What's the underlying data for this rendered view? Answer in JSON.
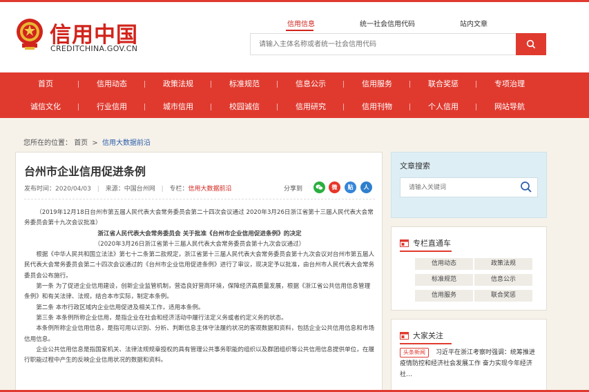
{
  "header": {
    "logo_cn": "信用中国",
    "logo_en": "CREDITCHINA.GOV.CN",
    "search_tabs": [
      "信用信息",
      "统一社会信用代码",
      "站内文章"
    ],
    "search_placeholder": "请输入主体名称或者统一社会信用代码"
  },
  "nav": {
    "row1": [
      "首页",
      "信用动态",
      "政策法规",
      "标准规范",
      "信息公示",
      "信用服务",
      "联合奖惩",
      "专项治理"
    ],
    "row2": [
      "诚信文化",
      "行业信用",
      "城市信用",
      "校园诚信",
      "信用研究",
      "信用刊物",
      "个人信用",
      "网站导航"
    ]
  },
  "breadcrumb": {
    "prefix": "您所在的位置：",
    "home": "首页",
    "sep": ">",
    "current": "信用大数据前沿"
  },
  "article": {
    "title": "台州市企业信用促进条例",
    "publish_label": "发布时间：",
    "publish_date": "2020/04/03",
    "source_label": "来源：",
    "source": "中国台州网",
    "column_label": "专栏：",
    "column": "信用大数据前沿",
    "share_label": "分享到",
    "share_weibo_glyph": "微",
    "share_tieba_glyph": "贴",
    "share_renren_glyph": "人",
    "paragraphs": [
      "（2019年12月18日台州市第五届人民代表大会常务委员会第二十四次会议通过 2020年3月26日浙江省第十三届人民代表大会常务委员会第十九次会议批准）",
      "浙江省人民代表大会常务委员会 关于批准《台州市企业信用促进条例》的决定",
      "（2020年3月26日浙江省第十三届人民代表大会常务委员会第十九次会议通过）",
      "根据《中华人民共和国立法法》第七十二条第二款规定，浙江省第十三届人民代表大会常务委员会第十九次会议对台州市第五届人民代表大会常务委员会第二十四次会议通过的《台州市企业信用促进条例》进行了审议，现决定予以批准，由台州市人民代表大会常务委员会公布施行。",
      "第一条 为了促进企业信用建设，创新企业监管机制，营造良好营商环境，保障经济高质量发展，根据《浙江省公共信用信息管理条例》和有关法律、法规，结合本市实际，制定本条例。",
      "第二条 本市行政区域内企业信用促进及相关工作，适用本条例。",
      "第三条 本条例所称企业信用，是指企业在社会和经济活动中履行法定义务或者约定义务的状态。",
      "本条例所称企业信用信息，是指可用以识别、分析、判断信息主体守法履约状况的客观数据和资料，包括企业公共信用信息和市场信用信息。",
      "企业公共信用信息是指国家机关、法律法规规章授权的具有管理公共事务职能的组织以及群团组织等公共信用信息提供单位，在履行职能过程中产生的反映企业信用状况的数据和资料。"
    ]
  },
  "sidebar": {
    "search_title": "文章搜索",
    "search_placeholder": "请输入关键词",
    "channels_title": "专栏直通车",
    "channels": [
      "信用动态",
      "政策法规",
      "标准规范",
      "信息公示",
      "信用服务",
      "联合奖惩"
    ],
    "attention_title": "大家关注",
    "news_badge": "头条新闻",
    "news_text": "习近平在浙江考察时强调：统筹推进疫情防控和经济社会发展工作 奋力实现今年经济社…"
  },
  "colors": {
    "brand_red": "#e03a2f",
    "link_blue": "#2a5ca8",
    "page_bg": "#f6f2ea",
    "wechat_green": "#2aae3f",
    "weibo_red": "#e6352a",
    "tieba_blue": "#3585d8",
    "renren_blue": "#2f7fcd"
  },
  "icons": {
    "emblem": "national-emblem-icon",
    "search": "search-icon",
    "wechat": "wechat-icon",
    "weibo": "weibo-icon",
    "tieba": "tieba-icon",
    "renren": "renren-icon",
    "panel": "panel-window-icon"
  }
}
